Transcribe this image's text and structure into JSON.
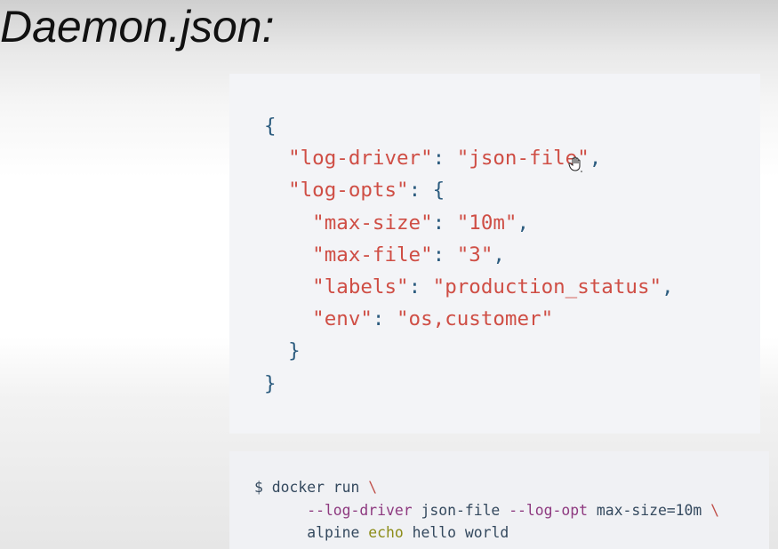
{
  "slide_title": "Daemon.json:",
  "json_code": [
    [
      {
        "t": "{",
        "c": "p"
      }
    ],
    [
      {
        "t": "  \"log-driver\"",
        "c": "s"
      },
      {
        "t": ": ",
        "c": "p"
      },
      {
        "t": "\"json-file\"",
        "c": "s"
      },
      {
        "t": ",",
        "c": "p"
      }
    ],
    [
      {
        "t": "  \"log-opts\"",
        "c": "s"
      },
      {
        "t": ": {",
        "c": "p"
      }
    ],
    [
      {
        "t": "    \"max-size\"",
        "c": "s"
      },
      {
        "t": ": ",
        "c": "p"
      },
      {
        "t": "\"10m\"",
        "c": "s"
      },
      {
        "t": ",",
        "c": "p"
      }
    ],
    [
      {
        "t": "    \"max-file\"",
        "c": "s"
      },
      {
        "t": ": ",
        "c": "p"
      },
      {
        "t": "\"3\"",
        "c": "s"
      },
      {
        "t": ",",
        "c": "p"
      }
    ],
    [
      {
        "t": "    \"labels\"",
        "c": "s"
      },
      {
        "t": ": ",
        "c": "p"
      },
      {
        "t": "\"production_status\"",
        "c": "s"
      },
      {
        "t": ",",
        "c": "p"
      }
    ],
    [
      {
        "t": "    \"env\"",
        "c": "s"
      },
      {
        "t": ": ",
        "c": "p"
      },
      {
        "t": "\"os,customer\"",
        "c": "s"
      }
    ],
    [
      {
        "t": "  }",
        "c": "p"
      }
    ],
    [
      {
        "t": "}",
        "c": "p"
      }
    ]
  ],
  "shell_code": [
    [
      {
        "t": "$ docker run ",
        "c": "d"
      },
      {
        "t": "\\",
        "c": "b"
      }
    ],
    [
      {
        "t": "      --log-driver",
        "c": "f"
      },
      {
        "t": " json-file ",
        "c": "d"
      },
      {
        "t": "--log-opt",
        "c": "f"
      },
      {
        "t": " max-size=10m ",
        "c": "d"
      },
      {
        "t": "\\",
        "c": "b"
      }
    ],
    [
      {
        "t": "      alpine ",
        "c": "d"
      },
      {
        "t": "echo",
        "c": "e"
      },
      {
        "t": " hello world",
        "c": "d"
      }
    ]
  ],
  "colors": {
    "json_string": "#cf4e45",
    "json_punct": "#2c5c7f",
    "shell_flag": "#8e3a80",
    "shell_builtin": "#8c8c18"
  },
  "cursor_icon": "hand-pointer-icon"
}
